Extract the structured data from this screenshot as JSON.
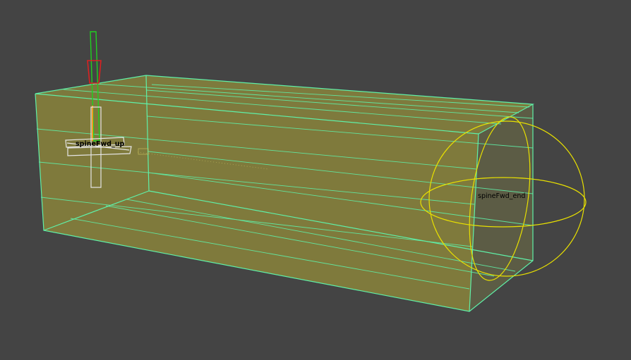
{
  "viewport": {
    "background": "#444444"
  },
  "colors": {
    "box_fill": "#8a8236",
    "box_face_fill": "#777a3e",
    "box_edge": "#5ff0a8",
    "sphere": "#e8e000",
    "label_text": "#000000",
    "control_white": "#e6e6e6",
    "axis_red": "#e02020",
    "axis_green": "#20d020",
    "joint_orange": "#f0a020"
  },
  "objects": {
    "start_control": {
      "label": "spineFwd_up",
      "icon": "pivot-cross-control-icon"
    },
    "end_control": {
      "label": "spineFwd_end",
      "icon": "sphere-control-icon"
    },
    "bounding_box": {
      "icon": "mesh-bounding-box-icon"
    }
  }
}
